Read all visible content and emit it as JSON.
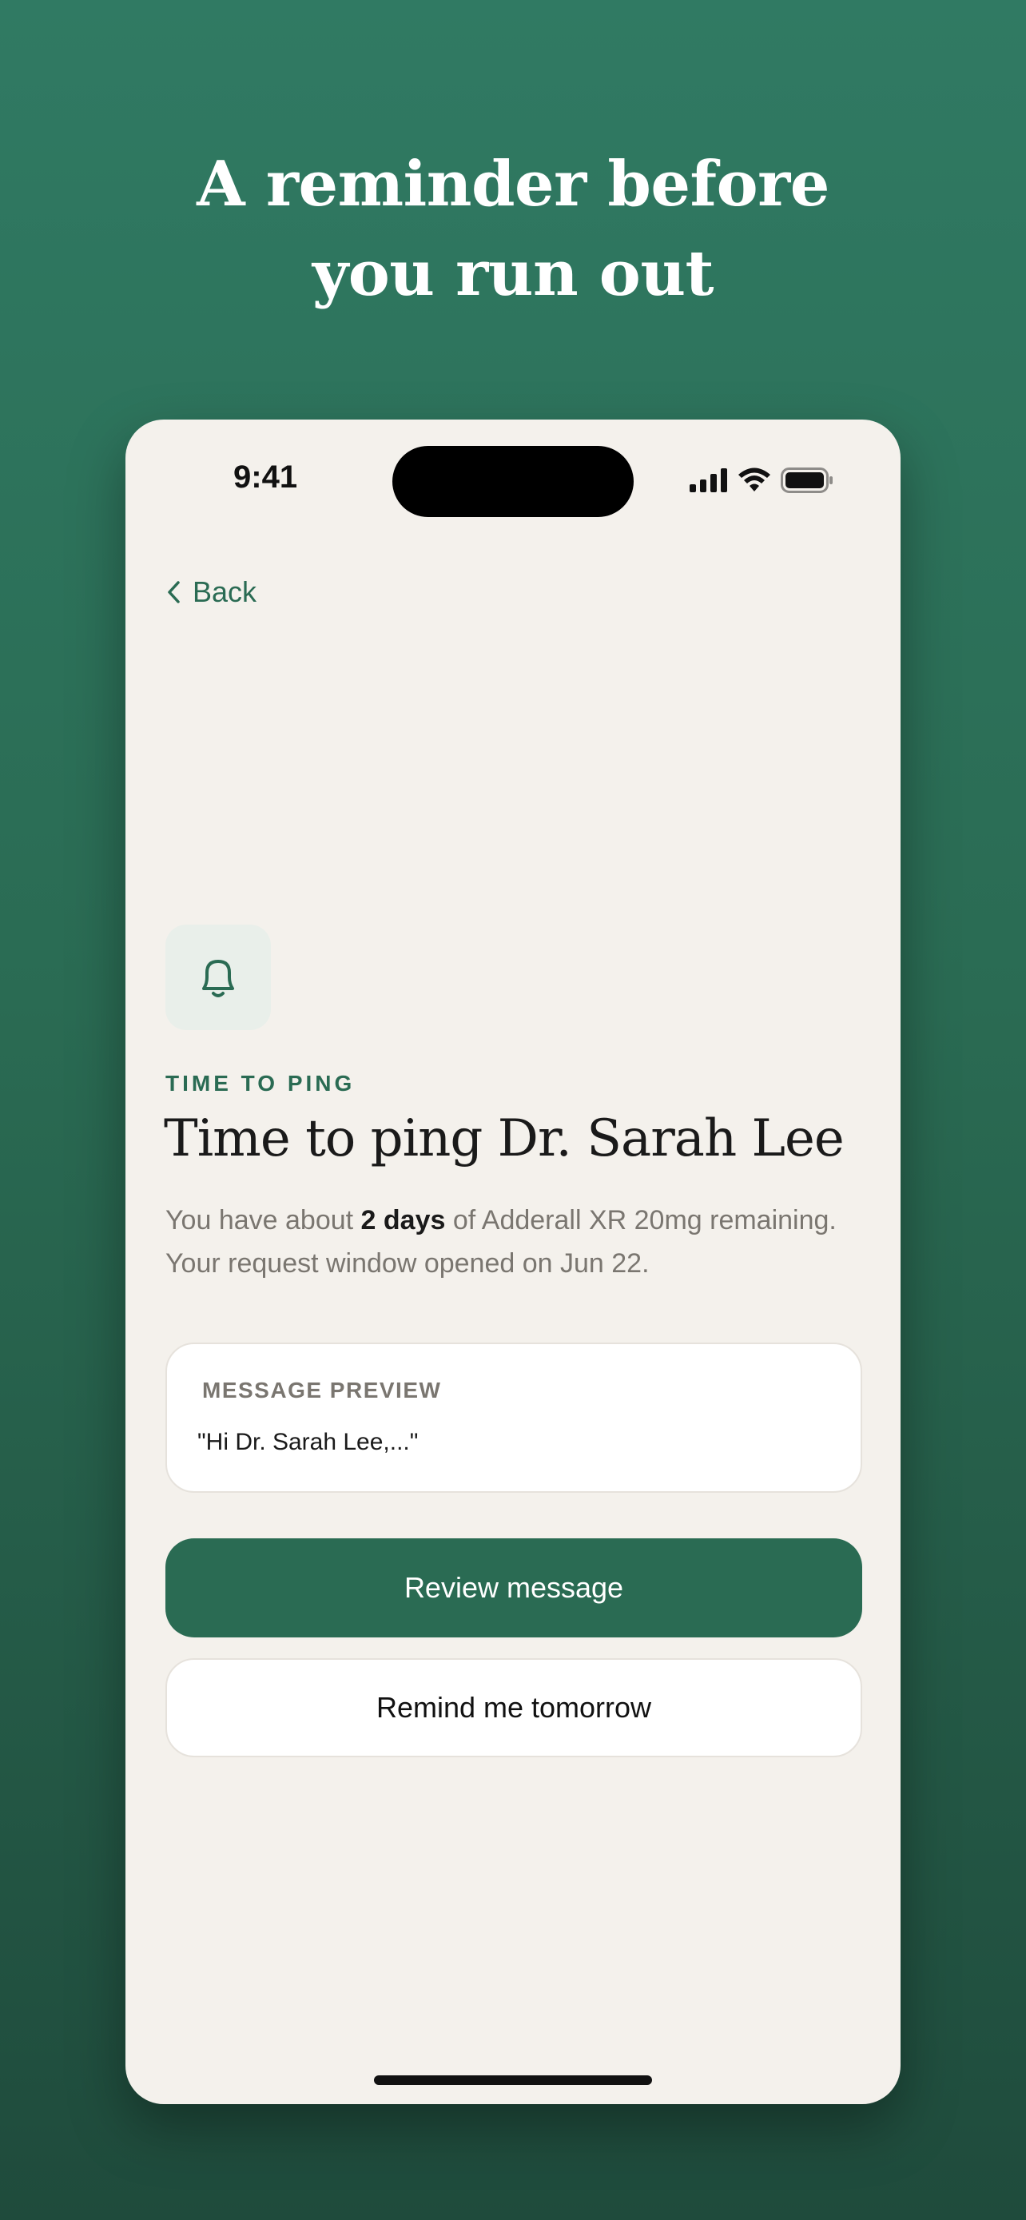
{
  "headline": {
    "line1": "A reminder before",
    "line2": "you run out"
  },
  "status_bar": {
    "time": "9:41",
    "icons": [
      "cellular-signal-icon",
      "wifi-icon",
      "battery-icon"
    ]
  },
  "nav": {
    "back_label": "Back",
    "back_icon": "chevron-left-icon"
  },
  "reminder": {
    "icon": "bell-icon",
    "eyebrow": "TIME TO PING",
    "title": "Time to ping Dr. Sarah Lee",
    "body_prefix": "You have about ",
    "body_emphasis": "2 days",
    "body_suffix": " of Adderall XR 20mg remaining. Your request window opened on Jun 22."
  },
  "message_preview": {
    "label": "MESSAGE PREVIEW",
    "text": "\"Hi Dr. Sarah Lee,...\""
  },
  "actions": {
    "primary_label": "Review message",
    "secondary_label": "Remind me tomorrow"
  },
  "colors": {
    "brand_green": "#2a6b53",
    "background": "#f4f1ec",
    "text_dark": "#1a1a1a",
    "text_muted": "#7a7670"
  }
}
